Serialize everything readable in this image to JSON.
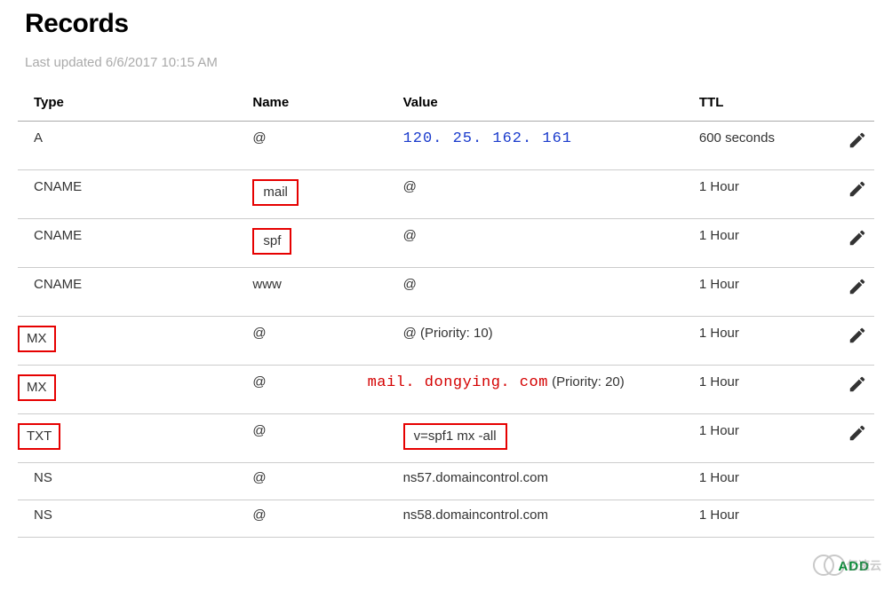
{
  "header": {
    "title": "Records",
    "last_updated": "Last updated 6/6/2017 10:15 AM"
  },
  "table": {
    "columns": {
      "type": "Type",
      "name": "Name",
      "value": "Value",
      "ttl": "TTL"
    }
  },
  "records": {
    "r0": {
      "type": "A",
      "name": "@",
      "value": "120. 25. 162. 161",
      "ttl": "600 seconds"
    },
    "r1": {
      "type": "CNAME",
      "name": "mail",
      "value": "@",
      "ttl": "1 Hour"
    },
    "r2": {
      "type": "CNAME",
      "name": "spf",
      "value": "@",
      "ttl": "1 Hour"
    },
    "r3": {
      "type": "CNAME",
      "name": "www",
      "value": "@",
      "ttl": "1 Hour"
    },
    "r4": {
      "type": "MX",
      "name": "@",
      "value": "@ (Priority: 10)",
      "ttl": "1 Hour"
    },
    "r5": {
      "type": "MX",
      "name": "@",
      "value_prefix": "mail. dongying. com",
      "value_suffix": "(Priority: 20)",
      "ttl": "1 Hour"
    },
    "r6": {
      "type": "TXT",
      "name": "@",
      "value": "v=spf1 mx -all",
      "ttl": "1 Hour"
    },
    "r7": {
      "type": "NS",
      "name": "@",
      "value": "ns57.domaincontrol.com",
      "ttl": "1 Hour"
    },
    "r8": {
      "type": "NS",
      "name": "@",
      "value": "ns58.domaincontrol.com",
      "ttl": "1 Hour"
    }
  },
  "buttons": {
    "add": "ADD"
  },
  "watermark": {
    "text": "亿速云"
  }
}
